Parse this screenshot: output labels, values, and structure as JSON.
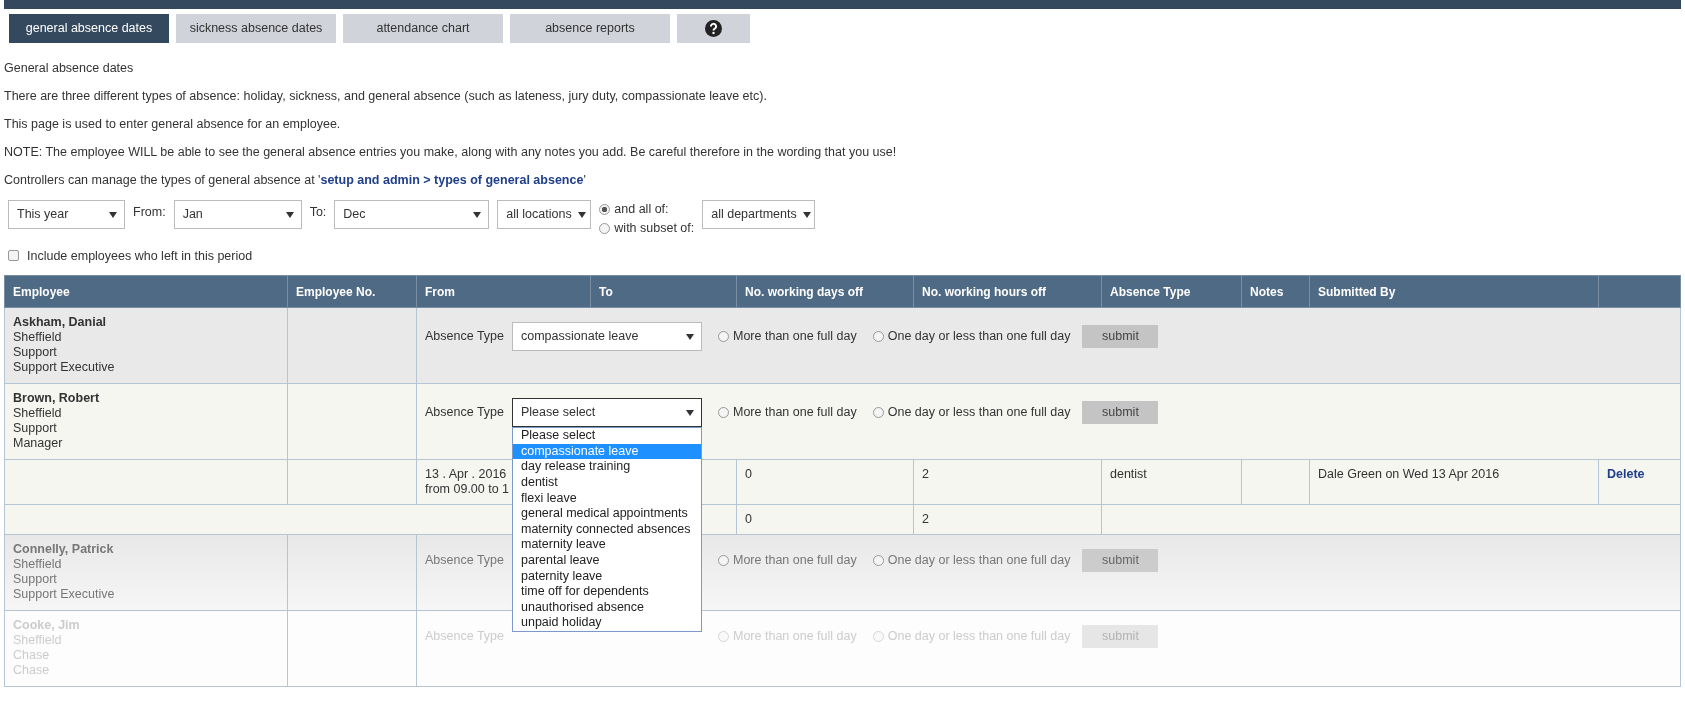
{
  "tabs": [
    {
      "kind": "text",
      "label": "general absence dates",
      "selected": true
    },
    {
      "kind": "text",
      "label": "sickness absence dates",
      "selected": false
    },
    {
      "kind": "text",
      "label": "attendance chart",
      "selected": false
    },
    {
      "kind": "text",
      "label": "absence reports",
      "selected": false
    },
    {
      "kind": "help",
      "selected": false
    }
  ],
  "intro": {
    "heading": "General absence dates",
    "paragraphs": [
      "There are three different types of absence: holiday, sickness, and general absence (such as lateness, jury duty, compassionate leave etc).",
      "This page is used to enter general absence for an employee.",
      "NOTE: The employee WILL be able to see the general absence entries you make, along with any notes you add. Be careful therefore in the wording that you use!"
    ],
    "admin_note": {
      "before": "Controllers can manage the types of general absence at '",
      "link": "setup and admin > types of general absence",
      "after": "'"
    }
  },
  "filters": {
    "period": "This year",
    "from_label": "From:",
    "from": "Jan",
    "to_label": "To:",
    "to": "Dec",
    "location": "all locations",
    "match_options": [
      {
        "label": "and all of:",
        "selected": true
      },
      {
        "label": "with subset of:",
        "selected": false
      }
    ],
    "department": "all departments",
    "include_leavers": {
      "label": "Include employees who left in this period",
      "checked": false
    }
  },
  "table": {
    "columns": [
      "Employee",
      "Employee No.",
      "From",
      "To",
      "No. working days off",
      "No. working hours off",
      "Absence Type",
      "Notes",
      "Submitted By"
    ],
    "rows": [
      {
        "kind": "employee",
        "name": "Askham, Danial",
        "details": [
          "Sheffield",
          "Support",
          "Support Executive"
        ],
        "form": {
          "label": "Absence Type",
          "value": "compassionate leave",
          "radios": [
            {
              "label": "More than one full day",
              "selected": false
            },
            {
              "label": "One day or less than one full day",
              "selected": false
            }
          ],
          "submit": "submit"
        }
      },
      {
        "kind": "employee",
        "name": "Brown, Robert",
        "details": [
          "Sheffield",
          "Support",
          "Manager"
        ],
        "form": {
          "label": "Absence Type",
          "value": "Please select",
          "open": true,
          "options": [
            {
              "label": "Please select",
              "highlighted": false
            },
            {
              "label": "compassionate leave",
              "highlighted": true
            },
            {
              "label": "day release training",
              "highlighted": false
            },
            {
              "label": "dentist",
              "highlighted": false
            },
            {
              "label": "flexi leave",
              "highlighted": false
            },
            {
              "label": "general medical appointments",
              "highlighted": false
            },
            {
              "label": "maternity connected absences",
              "highlighted": false
            },
            {
              "label": "maternity leave",
              "highlighted": false
            },
            {
              "label": "parental leave",
              "highlighted": false
            },
            {
              "label": "paternity leave",
              "highlighted": false
            },
            {
              "label": "time off for dependents",
              "highlighted": false
            },
            {
              "label": "unauthorised absence",
              "highlighted": false
            },
            {
              "label": "unpaid holiday",
              "highlighted": false
            }
          ],
          "radios": [
            {
              "label": "More than one full day",
              "selected": false
            },
            {
              "label": "One day or less than one full day",
              "selected": false
            }
          ],
          "submit": "submit"
        }
      },
      {
        "kind": "absence",
        "date": "13 . Apr . 2016",
        "time": "from 09.00 to 1",
        "days": "0",
        "hours": "2",
        "type": "dentist",
        "submitted_by": "Dale Green on Wed 13 Apr 2016",
        "action": "Delete"
      },
      {
        "kind": "total",
        "days": "0",
        "hours": "2"
      },
      {
        "kind": "employee",
        "name": "Connelly, Patrick",
        "details": [
          "Sheffield",
          "Support",
          "Support Executive"
        ],
        "form": {
          "label": "Absence Type",
          "radios": [
            {
              "label": "More than one full day",
              "selected": false
            },
            {
              "label": "One day or less than one full day",
              "selected": false
            }
          ],
          "submit": "submit"
        }
      },
      {
        "kind": "employee",
        "name": "Cooke, Jim",
        "details": [
          "Sheffield",
          "Chase",
          "Chase"
        ],
        "form": {
          "label": "Absence Type",
          "radios": [
            {
              "label": "More than one full day",
              "selected": false
            },
            {
              "label": "One day or less than one full day",
              "selected": false
            }
          ],
          "submit": "submit"
        }
      }
    ]
  }
}
